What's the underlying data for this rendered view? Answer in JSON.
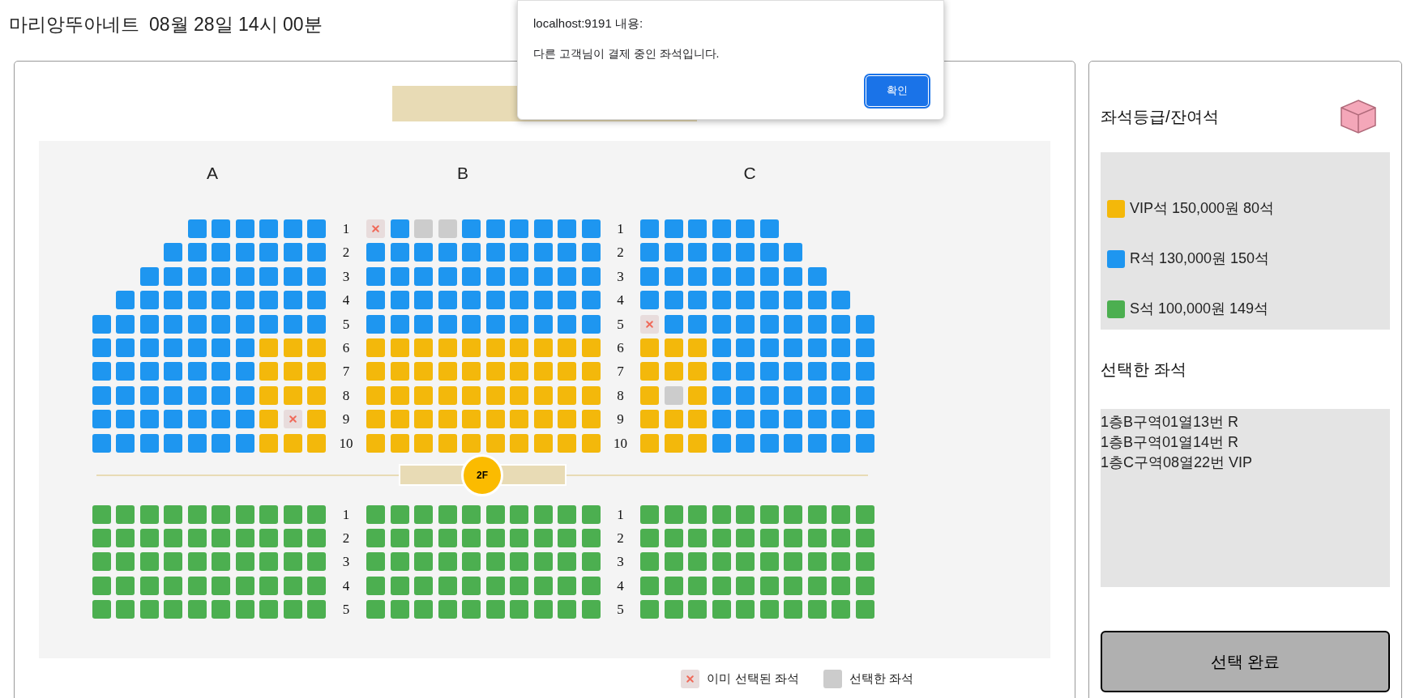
{
  "show_name": "마리앙뚜아네트",
  "show_time": "08월 28일 14시 00분",
  "floors": [
    {
      "sections": [
        {
          "label": "A",
          "rows": [
            {
              "seats": [
                {
                  "kind": "r"
                },
                {
                  "kind": "r"
                },
                {
                  "kind": "r"
                },
                {
                  "kind": "r"
                },
                {
                  "kind": "r"
                },
                {
                  "kind": "r"
                }
              ]
            },
            {
              "seats": [
                {
                  "kind": "r"
                },
                {
                  "kind": "r"
                },
                {
                  "kind": "r"
                },
                {
                  "kind": "r"
                },
                {
                  "kind": "r"
                },
                {
                  "kind": "r"
                },
                {
                  "kind": "r"
                }
              ]
            },
            {
              "seats": [
                {
                  "kind": "r"
                },
                {
                  "kind": "r"
                },
                {
                  "kind": "r"
                },
                {
                  "kind": "r"
                },
                {
                  "kind": "r"
                },
                {
                  "kind": "r"
                },
                {
                  "kind": "r"
                },
                {
                  "kind": "r"
                }
              ]
            },
            {
              "seats": [
                {
                  "kind": "r"
                },
                {
                  "kind": "r"
                },
                {
                  "kind": "r"
                },
                {
                  "kind": "r"
                },
                {
                  "kind": "r"
                },
                {
                  "kind": "r"
                },
                {
                  "kind": "r"
                },
                {
                  "kind": "r"
                },
                {
                  "kind": "r"
                }
              ]
            },
            {
              "seats": [
                {
                  "kind": "r"
                },
                {
                  "kind": "r"
                },
                {
                  "kind": "r"
                },
                {
                  "kind": "r"
                },
                {
                  "kind": "r"
                },
                {
                  "kind": "r"
                },
                {
                  "kind": "r"
                },
                {
                  "kind": "r"
                },
                {
                  "kind": "r"
                },
                {
                  "kind": "r"
                }
              ]
            },
            {
              "seats": [
                {
                  "kind": "r"
                },
                {
                  "kind": "r"
                },
                {
                  "kind": "r"
                },
                {
                  "kind": "r"
                },
                {
                  "kind": "r"
                },
                {
                  "kind": "r"
                },
                {
                  "kind": "r"
                },
                {
                  "kind": "vip"
                },
                {
                  "kind": "vip"
                },
                {
                  "kind": "vip"
                }
              ]
            },
            {
              "seats": [
                {
                  "kind": "r"
                },
                {
                  "kind": "r"
                },
                {
                  "kind": "r"
                },
                {
                  "kind": "r"
                },
                {
                  "kind": "r"
                },
                {
                  "kind": "r"
                },
                {
                  "kind": "r"
                },
                {
                  "kind": "vip"
                },
                {
                  "kind": "vip"
                },
                {
                  "kind": "vip"
                }
              ]
            },
            {
              "seats": [
                {
                  "kind": "r"
                },
                {
                  "kind": "r"
                },
                {
                  "kind": "r"
                },
                {
                  "kind": "r"
                },
                {
                  "kind": "r"
                },
                {
                  "kind": "r"
                },
                {
                  "kind": "r"
                },
                {
                  "kind": "vip"
                },
                {
                  "kind": "vip"
                },
                {
                  "kind": "vip"
                }
              ]
            },
            {
              "seats": [
                {
                  "kind": "r"
                },
                {
                  "kind": "r"
                },
                {
                  "kind": "r"
                },
                {
                  "kind": "r"
                },
                {
                  "kind": "r"
                },
                {
                  "kind": "r"
                },
                {
                  "kind": "r"
                },
                {
                  "kind": "vip"
                },
                {
                  "kind": "taken"
                },
                {
                  "kind": "vip"
                }
              ]
            },
            {
              "seats": [
                {
                  "kind": "r"
                },
                {
                  "kind": "r"
                },
                {
                  "kind": "r"
                },
                {
                  "kind": "r"
                },
                {
                  "kind": "r"
                },
                {
                  "kind": "r"
                },
                {
                  "kind": "r"
                },
                {
                  "kind": "vip"
                },
                {
                  "kind": "vip"
                },
                {
                  "kind": "vip"
                }
              ]
            }
          ]
        },
        {
          "label": "B",
          "rows": [
            {
              "number": "1",
              "seats": [
                {
                  "kind": "taken"
                },
                {
                  "kind": "r"
                },
                {
                  "kind": "picked"
                },
                {
                  "kind": "picked"
                },
                {
                  "kind": "r"
                },
                {
                  "kind": "r"
                },
                {
                  "kind": "r"
                },
                {
                  "kind": "r"
                },
                {
                  "kind": "r"
                },
                {
                  "kind": "r"
                }
              ]
            },
            {
              "number": "2",
              "seats": [
                {
                  "kind": "r"
                },
                {
                  "kind": "r"
                },
                {
                  "kind": "r"
                },
                {
                  "kind": "r"
                },
                {
                  "kind": "r"
                },
                {
                  "kind": "r"
                },
                {
                  "kind": "r"
                },
                {
                  "kind": "r"
                },
                {
                  "kind": "r"
                },
                {
                  "kind": "r"
                }
              ]
            },
            {
              "number": "3",
              "seats": [
                {
                  "kind": "r"
                },
                {
                  "kind": "r"
                },
                {
                  "kind": "r"
                },
                {
                  "kind": "r"
                },
                {
                  "kind": "r"
                },
                {
                  "kind": "r"
                },
                {
                  "kind": "r"
                },
                {
                  "kind": "r"
                },
                {
                  "kind": "r"
                },
                {
                  "kind": "r"
                }
              ]
            },
            {
              "number": "4",
              "seats": [
                {
                  "kind": "r"
                },
                {
                  "kind": "r"
                },
                {
                  "kind": "r"
                },
                {
                  "kind": "r"
                },
                {
                  "kind": "r"
                },
                {
                  "kind": "r"
                },
                {
                  "kind": "r"
                },
                {
                  "kind": "r"
                },
                {
                  "kind": "r"
                },
                {
                  "kind": "r"
                }
              ]
            },
            {
              "number": "5",
              "seats": [
                {
                  "kind": "r"
                },
                {
                  "kind": "r"
                },
                {
                  "kind": "r"
                },
                {
                  "kind": "r"
                },
                {
                  "kind": "r"
                },
                {
                  "kind": "r"
                },
                {
                  "kind": "r"
                },
                {
                  "kind": "r"
                },
                {
                  "kind": "r"
                },
                {
                  "kind": "r"
                }
              ]
            },
            {
              "number": "6",
              "seats": [
                {
                  "kind": "vip"
                },
                {
                  "kind": "vip"
                },
                {
                  "kind": "vip"
                },
                {
                  "kind": "vip"
                },
                {
                  "kind": "vip"
                },
                {
                  "kind": "vip"
                },
                {
                  "kind": "vip"
                },
                {
                  "kind": "vip"
                },
                {
                  "kind": "vip"
                },
                {
                  "kind": "vip"
                }
              ]
            },
            {
              "number": "7",
              "seats": [
                {
                  "kind": "vip"
                },
                {
                  "kind": "vip"
                },
                {
                  "kind": "vip"
                },
                {
                  "kind": "vip"
                },
                {
                  "kind": "vip"
                },
                {
                  "kind": "vip"
                },
                {
                  "kind": "vip"
                },
                {
                  "kind": "vip"
                },
                {
                  "kind": "vip"
                },
                {
                  "kind": "vip"
                }
              ]
            },
            {
              "number": "8",
              "seats": [
                {
                  "kind": "vip"
                },
                {
                  "kind": "vip"
                },
                {
                  "kind": "vip"
                },
                {
                  "kind": "vip"
                },
                {
                  "kind": "vip"
                },
                {
                  "kind": "vip"
                },
                {
                  "kind": "vip"
                },
                {
                  "kind": "vip"
                },
                {
                  "kind": "vip"
                },
                {
                  "kind": "vip"
                }
              ]
            },
            {
              "number": "9",
              "seats": [
                {
                  "kind": "vip"
                },
                {
                  "kind": "vip"
                },
                {
                  "kind": "vip"
                },
                {
                  "kind": "vip"
                },
                {
                  "kind": "vip"
                },
                {
                  "kind": "vip"
                },
                {
                  "kind": "vip"
                },
                {
                  "kind": "vip"
                },
                {
                  "kind": "vip"
                },
                {
                  "kind": "vip"
                }
              ]
            },
            {
              "number": "10",
              "seats": [
                {
                  "kind": "vip"
                },
                {
                  "kind": "vip"
                },
                {
                  "kind": "vip"
                },
                {
                  "kind": "vip"
                },
                {
                  "kind": "vip"
                },
                {
                  "kind": "vip"
                },
                {
                  "kind": "vip"
                },
                {
                  "kind": "vip"
                },
                {
                  "kind": "vip"
                },
                {
                  "kind": "vip"
                }
              ]
            }
          ]
        },
        {
          "label": "C",
          "rows": [
            {
              "number": "1",
              "seats": [
                {
                  "kind": "r"
                },
                {
                  "kind": "r"
                },
                {
                  "kind": "r"
                },
                {
                  "kind": "r"
                },
                {
                  "kind": "r"
                },
                {
                  "kind": "r"
                }
              ]
            },
            {
              "number": "2",
              "seats": [
                {
                  "kind": "r"
                },
                {
                  "kind": "r"
                },
                {
                  "kind": "r"
                },
                {
                  "kind": "r"
                },
                {
                  "kind": "r"
                },
                {
                  "kind": "r"
                },
                {
                  "kind": "r"
                }
              ]
            },
            {
              "number": "3",
              "seats": [
                {
                  "kind": "r"
                },
                {
                  "kind": "r"
                },
                {
                  "kind": "r"
                },
                {
                  "kind": "r"
                },
                {
                  "kind": "r"
                },
                {
                  "kind": "r"
                },
                {
                  "kind": "r"
                },
                {
                  "kind": "r"
                }
              ]
            },
            {
              "number": "4",
              "seats": [
                {
                  "kind": "r"
                },
                {
                  "kind": "r"
                },
                {
                  "kind": "r"
                },
                {
                  "kind": "r"
                },
                {
                  "kind": "r"
                },
                {
                  "kind": "r"
                },
                {
                  "kind": "r"
                },
                {
                  "kind": "r"
                },
                {
                  "kind": "r"
                }
              ]
            },
            {
              "number": "5",
              "seats": [
                {
                  "kind": "taken"
                },
                {
                  "kind": "r"
                },
                {
                  "kind": "r"
                },
                {
                  "kind": "r"
                },
                {
                  "kind": "r"
                },
                {
                  "kind": "r"
                },
                {
                  "kind": "r"
                },
                {
                  "kind": "r"
                },
                {
                  "kind": "r"
                },
                {
                  "kind": "r"
                }
              ]
            },
            {
              "number": "6",
              "seats": [
                {
                  "kind": "vip"
                },
                {
                  "kind": "vip"
                },
                {
                  "kind": "vip"
                },
                {
                  "kind": "r"
                },
                {
                  "kind": "r"
                },
                {
                  "kind": "r"
                },
                {
                  "kind": "r"
                },
                {
                  "kind": "r"
                },
                {
                  "kind": "r"
                },
                {
                  "kind": "r"
                }
              ]
            },
            {
              "number": "7",
              "seats": [
                {
                  "kind": "vip"
                },
                {
                  "kind": "vip"
                },
                {
                  "kind": "vip"
                },
                {
                  "kind": "r"
                },
                {
                  "kind": "r"
                },
                {
                  "kind": "r"
                },
                {
                  "kind": "r"
                },
                {
                  "kind": "r"
                },
                {
                  "kind": "r"
                },
                {
                  "kind": "r"
                }
              ]
            },
            {
              "number": "8",
              "seats": [
                {
                  "kind": "vip"
                },
                {
                  "kind": "picked"
                },
                {
                  "kind": "vip"
                },
                {
                  "kind": "r"
                },
                {
                  "kind": "r"
                },
                {
                  "kind": "r"
                },
                {
                  "kind": "r"
                },
                {
                  "kind": "r"
                },
                {
                  "kind": "r"
                },
                {
                  "kind": "r"
                }
              ]
            },
            {
              "number": "9",
              "seats": [
                {
                  "kind": "vip"
                },
                {
                  "kind": "vip"
                },
                {
                  "kind": "vip"
                },
                {
                  "kind": "r"
                },
                {
                  "kind": "r"
                },
                {
                  "kind": "r"
                },
                {
                  "kind": "r"
                },
                {
                  "kind": "r"
                },
                {
                  "kind": "r"
                },
                {
                  "kind": "r"
                }
              ]
            },
            {
              "number": "10",
              "seats": [
                {
                  "kind": "vip"
                },
                {
                  "kind": "vip"
                },
                {
                  "kind": "vip"
                },
                {
                  "kind": "r"
                },
                {
                  "kind": "r"
                },
                {
                  "kind": "r"
                },
                {
                  "kind": "r"
                },
                {
                  "kind": "r"
                },
                {
                  "kind": "r"
                },
                {
                  "kind": "r"
                }
              ]
            }
          ]
        }
      ]
    },
    {
      "divider_label": "2F",
      "sections": [
        {
          "rows": [
            {
              "seats": [
                {
                  "kind": "s"
                },
                {
                  "kind": "s"
                },
                {
                  "kind": "s"
                },
                {
                  "kind": "s"
                },
                {
                  "kind": "s"
                },
                {
                  "kind": "s"
                },
                {
                  "kind": "s"
                },
                {
                  "kind": "s"
                },
                {
                  "kind": "s"
                },
                {
                  "kind": "s"
                }
              ]
            },
            {
              "seats": [
                {
                  "kind": "s"
                },
                {
                  "kind": "s"
                },
                {
                  "kind": "s"
                },
                {
                  "kind": "s"
                },
                {
                  "kind": "s"
                },
                {
                  "kind": "s"
                },
                {
                  "kind": "s"
                },
                {
                  "kind": "s"
                },
                {
                  "kind": "s"
                },
                {
                  "kind": "s"
                }
              ]
            },
            {
              "seats": [
                {
                  "kind": "s"
                },
                {
                  "kind": "s"
                },
                {
                  "kind": "s"
                },
                {
                  "kind": "s"
                },
                {
                  "kind": "s"
                },
                {
                  "kind": "s"
                },
                {
                  "kind": "s"
                },
                {
                  "kind": "s"
                },
                {
                  "kind": "s"
                },
                {
                  "kind": "s"
                }
              ]
            },
            {
              "seats": [
                {
                  "kind": "s"
                },
                {
                  "kind": "s"
                },
                {
                  "kind": "s"
                },
                {
                  "kind": "s"
                },
                {
                  "kind": "s"
                },
                {
                  "kind": "s"
                },
                {
                  "kind": "s"
                },
                {
                  "kind": "s"
                },
                {
                  "kind": "s"
                },
                {
                  "kind": "s"
                }
              ]
            },
            {
              "seats": [
                {
                  "kind": "s"
                },
                {
                  "kind": "s"
                },
                {
                  "kind": "s"
                },
                {
                  "kind": "s"
                },
                {
                  "kind": "s"
                },
                {
                  "kind": "s"
                },
                {
                  "kind": "s"
                },
                {
                  "kind": "s"
                },
                {
                  "kind": "s"
                },
                {
                  "kind": "s"
                }
              ]
            }
          ]
        },
        {
          "rows": [
            {
              "number": "1",
              "seats": [
                {
                  "kind": "s"
                },
                {
                  "kind": "s"
                },
                {
                  "kind": "s"
                },
                {
                  "kind": "s"
                },
                {
                  "kind": "s"
                },
                {
                  "kind": "s"
                },
                {
                  "kind": "s"
                },
                {
                  "kind": "s"
                },
                {
                  "kind": "s"
                },
                {
                  "kind": "s"
                }
              ]
            },
            {
              "number": "2",
              "seats": [
                {
                  "kind": "s"
                },
                {
                  "kind": "s"
                },
                {
                  "kind": "s"
                },
                {
                  "kind": "s"
                },
                {
                  "kind": "s"
                },
                {
                  "kind": "s"
                },
                {
                  "kind": "s"
                },
                {
                  "kind": "s"
                },
                {
                  "kind": "s"
                },
                {
                  "kind": "s"
                }
              ]
            },
            {
              "number": "3",
              "seats": [
                {
                  "kind": "s"
                },
                {
                  "kind": "s"
                },
                {
                  "kind": "s"
                },
                {
                  "kind": "s"
                },
                {
                  "kind": "s"
                },
                {
                  "kind": "s"
                },
                {
                  "kind": "s"
                },
                {
                  "kind": "s"
                },
                {
                  "kind": "s"
                },
                {
                  "kind": "s"
                }
              ]
            },
            {
              "number": "4",
              "seats": [
                {
                  "kind": "s"
                },
                {
                  "kind": "s"
                },
                {
                  "kind": "s"
                },
                {
                  "kind": "s"
                },
                {
                  "kind": "s"
                },
                {
                  "kind": "s"
                },
                {
                  "kind": "s"
                },
                {
                  "kind": "s"
                },
                {
                  "kind": "s"
                },
                {
                  "kind": "s"
                }
              ]
            },
            {
              "number": "5",
              "seats": [
                {
                  "kind": "s"
                },
                {
                  "kind": "s"
                },
                {
                  "kind": "s"
                },
                {
                  "kind": "s"
                },
                {
                  "kind": "s"
                },
                {
                  "kind": "s"
                },
                {
                  "kind": "s"
                },
                {
                  "kind": "s"
                },
                {
                  "kind": "s"
                },
                {
                  "kind": "s"
                }
              ]
            }
          ]
        },
        {
          "rows": [
            {
              "number": "1",
              "seats": [
                {
                  "kind": "s"
                },
                {
                  "kind": "s"
                },
                {
                  "kind": "s"
                },
                {
                  "kind": "s"
                },
                {
                  "kind": "s"
                },
                {
                  "kind": "s"
                },
                {
                  "kind": "s"
                },
                {
                  "kind": "s"
                },
                {
                  "kind": "s"
                },
                {
                  "kind": "s"
                }
              ]
            },
            {
              "number": "2",
              "seats": [
                {
                  "kind": "s"
                },
                {
                  "kind": "s"
                },
                {
                  "kind": "s"
                },
                {
                  "kind": "s"
                },
                {
                  "kind": "s"
                },
                {
                  "kind": "s"
                },
                {
                  "kind": "s"
                },
                {
                  "kind": "s"
                },
                {
                  "kind": "s"
                },
                {
                  "kind": "s"
                }
              ]
            },
            {
              "number": "3",
              "seats": [
                {
                  "kind": "s"
                },
                {
                  "kind": "s"
                },
                {
                  "kind": "s"
                },
                {
                  "kind": "s"
                },
                {
                  "kind": "s"
                },
                {
                  "kind": "s"
                },
                {
                  "kind": "s"
                },
                {
                  "kind": "s"
                },
                {
                  "kind": "s"
                },
                {
                  "kind": "s"
                }
              ]
            },
            {
              "number": "4",
              "seats": [
                {
                  "kind": "s"
                },
                {
                  "kind": "s"
                },
                {
                  "kind": "s"
                },
                {
                  "kind": "s"
                },
                {
                  "kind": "s"
                },
                {
                  "kind": "s"
                },
                {
                  "kind": "s"
                },
                {
                  "kind": "s"
                },
                {
                  "kind": "s"
                },
                {
                  "kind": "s"
                }
              ]
            },
            {
              "number": "5",
              "seats": [
                {
                  "kind": "s"
                },
                {
                  "kind": "s"
                },
                {
                  "kind": "s"
                },
                {
                  "kind": "s"
                },
                {
                  "kind": "s"
                },
                {
                  "kind": "s"
                },
                {
                  "kind": "s"
                },
                {
                  "kind": "s"
                },
                {
                  "kind": "s"
                },
                {
                  "kind": "s"
                }
              ]
            }
          ]
        }
      ]
    }
  ],
  "legend": [
    {
      "kind": "taken",
      "label": "이미 선택된 좌석"
    },
    {
      "kind": "picked",
      "label": "선택한 좌석"
    }
  ],
  "side": {
    "grades_title": "좌석등급/잔여석",
    "grades": [
      {
        "label": "VIP석 150,000원 80석",
        "color": "#f4b80a"
      },
      {
        "label": "R석 130,000원 150석",
        "color": "#1e96f0"
      },
      {
        "label": "S석 100,000원 149석",
        "color": "#4caf50"
      }
    ],
    "selected_title": "선택한 좌석",
    "selected": [
      "1층B구역01열13번 R",
      "1층B구역01열14번 R",
      "1층C구역08열22번 VIP"
    ],
    "confirm": "선택 완료"
  },
  "dialog": {
    "origin": "localhost:9191 내용:",
    "message": "다른 고객님이 결제 중인 좌석입니다.",
    "ok": "확인"
  }
}
